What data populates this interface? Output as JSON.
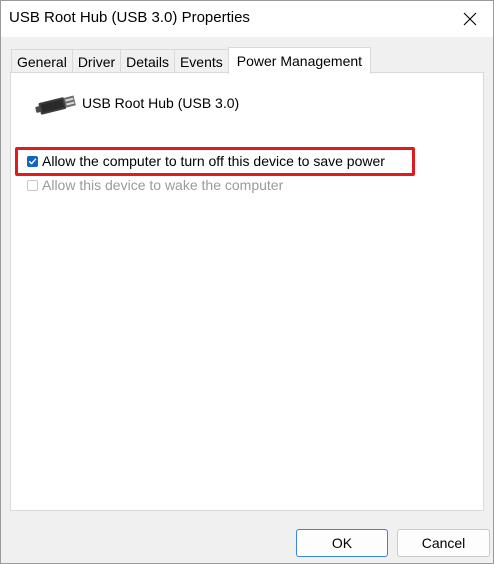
{
  "window": {
    "title": "USB Root Hub (USB 3.0) Properties",
    "close_icon": "close-icon"
  },
  "tabs": [
    {
      "label": "General",
      "active": false
    },
    {
      "label": "Driver",
      "active": false
    },
    {
      "label": "Details",
      "active": false
    },
    {
      "label": "Events",
      "active": false
    },
    {
      "label": "Power Management",
      "active": true
    }
  ],
  "device": {
    "icon": "usb-connector-icon",
    "name": "USB Root Hub (USB 3.0)"
  },
  "options": [
    {
      "label": "Allow the computer to turn off this device to save power",
      "checked": true,
      "enabled": true,
      "highlighted": true
    },
    {
      "label": "Allow this device to wake the computer",
      "checked": false,
      "enabled": false,
      "highlighted": false
    }
  ],
  "colors": {
    "highlight": "#e01b1b",
    "checkbox_accent": "#1565c0",
    "default_button_border": "#3a86d8"
  },
  "buttons": {
    "ok_label": "OK",
    "cancel_label": "Cancel"
  }
}
